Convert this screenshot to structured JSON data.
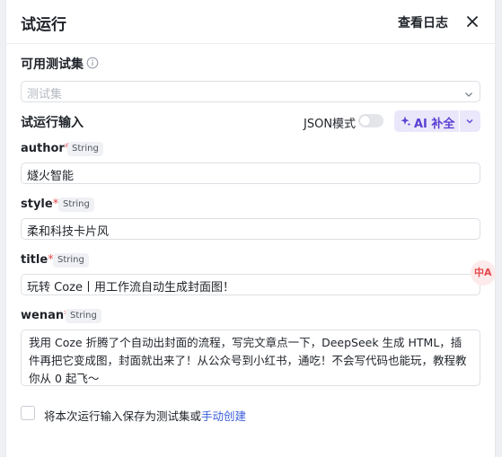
{
  "header": {
    "title": "试运行",
    "view_logs": "查看日志"
  },
  "test_set": {
    "label": "可用测试集",
    "placeholder": "测试集"
  },
  "run_input": {
    "label": "试运行输入",
    "json_mode_label": "JSON模式",
    "json_mode_on": false,
    "ai_fill_label": "AI 补全"
  },
  "fields": [
    {
      "name": "author",
      "required_mark": "*",
      "type": "String",
      "value": "燧火智能"
    },
    {
      "name": "style",
      "required_mark": "*",
      "type": "String",
      "value": "柔和科技卡片风"
    },
    {
      "name": "title",
      "required_mark": "*",
      "type": "String",
      "value": "玩转 Coze丨用工作流自动生成封面图！"
    },
    {
      "name": "wenan",
      "required_mark": "*",
      "type": "String",
      "value": "我用 Coze 折腾了个自动出封面的流程，写完文章点一下，DeepSeek 生成 HTML，插件再把它变成图，封面就出来了！从公众号到小红书，通吃！不会写代码也能玩，教程教你从 0 起飞～"
    }
  ],
  "save": {
    "text": "将本次运行输入保存为测试集或",
    "link": "手动创建",
    "checked": false
  },
  "floating_badge": "中A",
  "colors": {
    "accent": "#5a3fd4",
    "required": "#e5484d",
    "link": "#3a5ddb"
  }
}
